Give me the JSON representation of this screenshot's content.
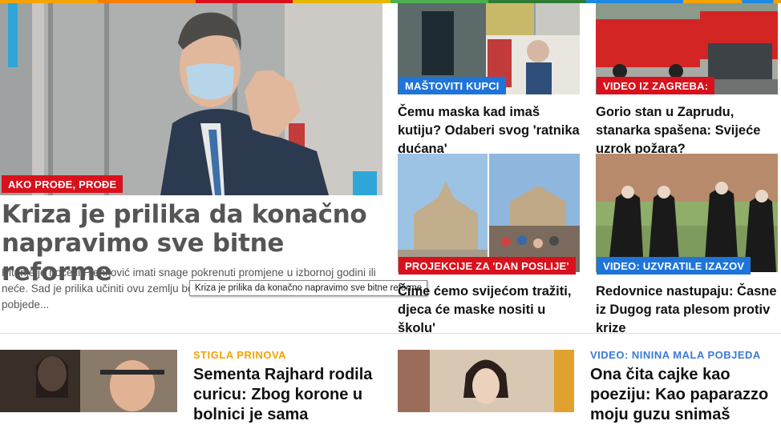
{
  "colors": {
    "strip": [
      "#f5a300",
      "#f57f00",
      "#d9111c",
      "#e6b800",
      "#4caf50",
      "#2e7d32",
      "#1e88e5",
      "#f5a300"
    ],
    "red": "#d9111c",
    "blue": "#1e74d9",
    "kicker_orange": "#f5a300",
    "kicker_blue": "#3a7bd5"
  },
  "lead": {
    "tag": "AKO PROĐE, PROĐE",
    "title": "Kriza je prilika da konačno napravimo sve bitne reforme",
    "text": "Pitanje je hoće li Plenković imati snage pokrenuti promjene u izbornoj godini ili neće. Sad je prilika učiniti ovu zemlju boljim mjestom nakon očekivane izborne pobjede...",
    "tooltip": "Kriza je prilika da konačno napravimo sve bitne reforme"
  },
  "cards": [
    {
      "tag": "MAŠTOVITI KUPCI",
      "title": "Čemu maska kad imaš kutiju? Odaberi svog 'ratnika dućana'"
    },
    {
      "tag": "VIDEO IZ ZAGREBA:",
      "title": "Gorio stan u Zaprudu, stanarka spašena: Svijeće uzrok požara?"
    },
    {
      "tag": "PROJEKCIJE ZA 'DAN POSLIJE'",
      "title": "Čime ćemo svijećom tražiti, djeca će maske nositi u školu'"
    },
    {
      "tag": "VIDEO: UZVRATILE IZAZOV",
      "title": "Redovnice nastupaju: Časne iz Dugog rata plesom protiv krize"
    }
  ],
  "bottom": [
    {
      "kicker": "STIGLA PRINOVA",
      "title": "Sementa Rajhard rodila curicu: Zbog korone u bolnici je sama"
    },
    {
      "kicker": "VIDEO: NININA MALA POBJEDA",
      "title": "Ona čita cajke kao poeziju: Kao paparazzo moju guzu snimaš"
    }
  ]
}
